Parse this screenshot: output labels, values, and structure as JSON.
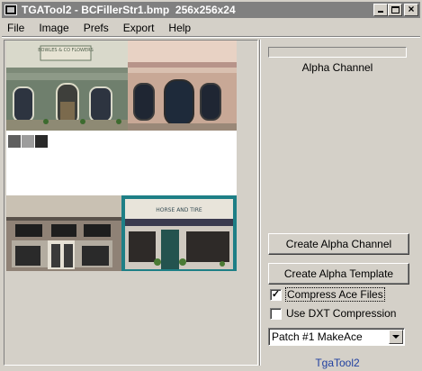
{
  "window": {
    "title": "TGATool2 - BCFillerStr1.bmp  256x256x24"
  },
  "menu": {
    "items": [
      "File",
      "Image",
      "Prefs",
      "Export",
      "Help"
    ]
  },
  "canvas": {
    "sign_top": "BOWLES & CO FLOWERS",
    "sign_bottom": "HORSE AND TIRE"
  },
  "panel": {
    "alpha_label": "Alpha Channel",
    "create_alpha_channel": "Create Alpha Channel",
    "create_alpha_template": "Create Alpha Template",
    "compress_ace": "Compress Ace Files",
    "compress_ace_checked": true,
    "use_dxt": "Use DXT Compression",
    "use_dxt_checked": false,
    "preset_value": "Patch #1 MakeAce",
    "footer": "TgaTool2"
  }
}
